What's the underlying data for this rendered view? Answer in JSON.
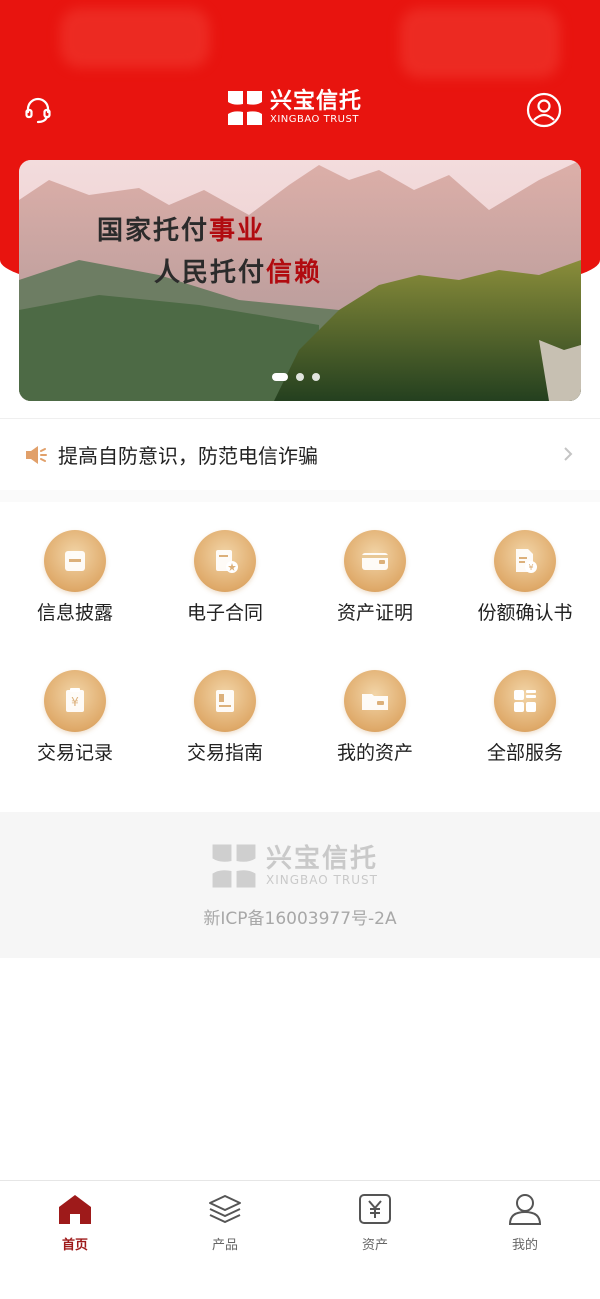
{
  "header": {
    "brand_cn": "兴宝信托",
    "brand_en": "XINGBAO TRUST",
    "support_icon": "headset-icon",
    "user_icon": "user-circle-icon",
    "color": "#e8140f"
  },
  "banner": {
    "line1_normal": "国家托付",
    "line1_highlight": "事业",
    "line2_normal": "人民托付",
    "line2_highlight": "信赖",
    "slides": 3,
    "active_slide": 1
  },
  "notice": {
    "text": "提高自防意识，防范电信诈骗",
    "icon": "speaker-icon"
  },
  "services": [
    {
      "label": "信息披露",
      "icon": "document-icon"
    },
    {
      "label": "电子合同",
      "icon": "contract-icon"
    },
    {
      "label": "资产证明",
      "icon": "wallet-icon"
    },
    {
      "label": "份额确认书",
      "icon": "certificate-icon"
    },
    {
      "label": "交易记录",
      "icon": "yuan-record-icon"
    },
    {
      "label": "交易指南",
      "icon": "guide-book-icon"
    },
    {
      "label": "我的资产",
      "icon": "folder-wallet-icon"
    },
    {
      "label": "全部服务",
      "icon": "grid-icon"
    }
  ],
  "footer": {
    "brand_cn": "兴宝信托",
    "brand_en": "XINGBAO TRUST",
    "icp": "新ICP备16003977号-2A"
  },
  "bottom_nav": [
    {
      "label": "首页",
      "icon": "home-icon",
      "active": true
    },
    {
      "label": "产品",
      "icon": "layers-icon",
      "active": false
    },
    {
      "label": "资产",
      "icon": "yuan-box-icon",
      "active": false
    },
    {
      "label": "我的",
      "icon": "person-icon",
      "active": false
    }
  ],
  "colors": {
    "accent_red": "#e8140f",
    "gold": "#dfaa6a",
    "nav_active": "#9e1a1a"
  }
}
